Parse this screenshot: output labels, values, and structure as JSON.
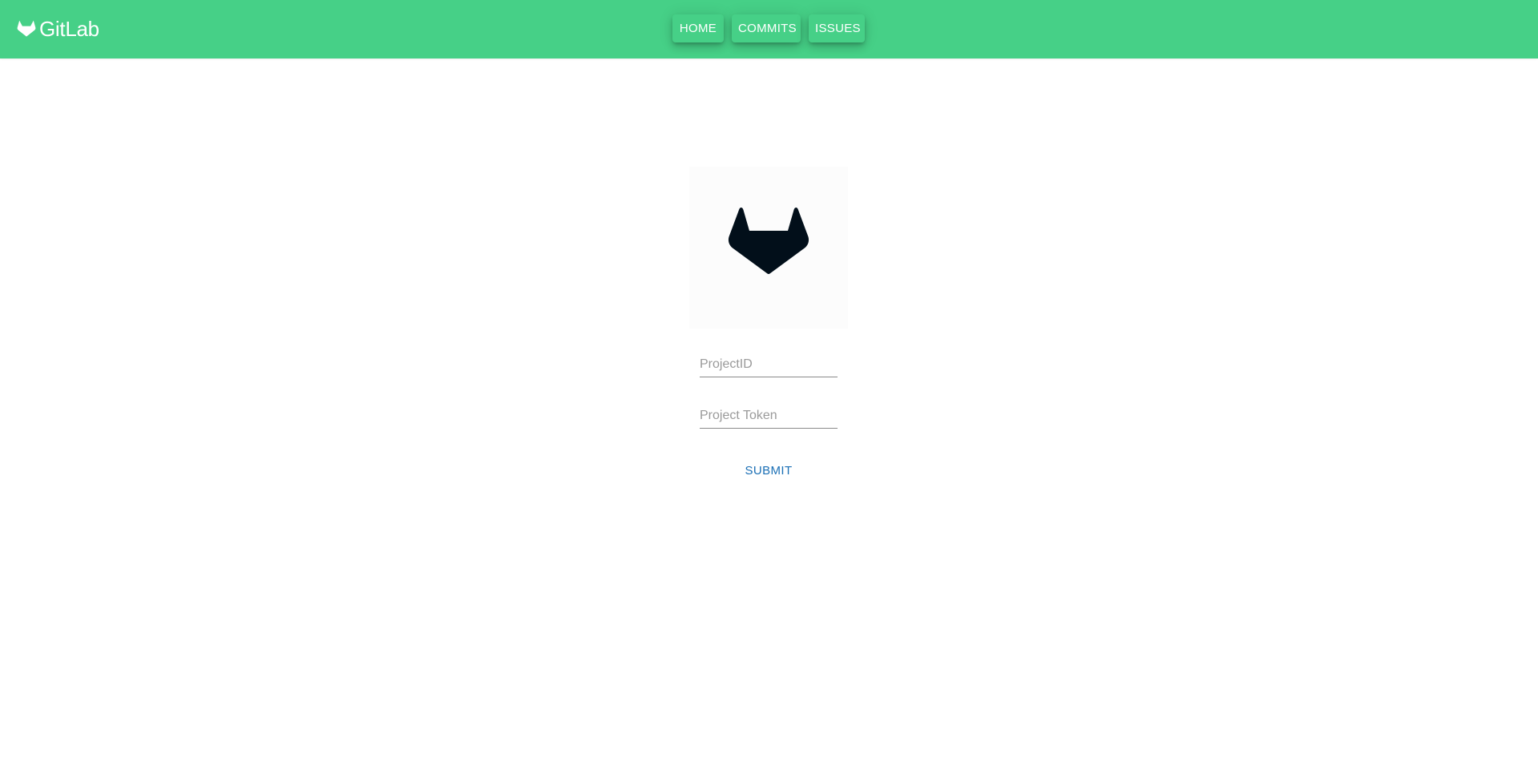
{
  "app": {
    "brand_name": "GitLab",
    "brand_icon": "gitlab-tanuki-icon"
  },
  "nav": {
    "items": [
      {
        "label": "HOME"
      },
      {
        "label": "COMMITS"
      },
      {
        "label": "ISSUES"
      }
    ]
  },
  "main": {
    "logo_icon": "gitlab-tanuki-icon",
    "project_id": {
      "placeholder": "ProjectID",
      "value": ""
    },
    "project_token": {
      "placeholder": "Project Token",
      "value": ""
    },
    "submit_label": "SUBMIT"
  },
  "colors": {
    "header_bg": "#46d087",
    "submit_text": "#1a6fb5",
    "logo_fill": "#020f1a",
    "brand_text": "#ffffff"
  }
}
